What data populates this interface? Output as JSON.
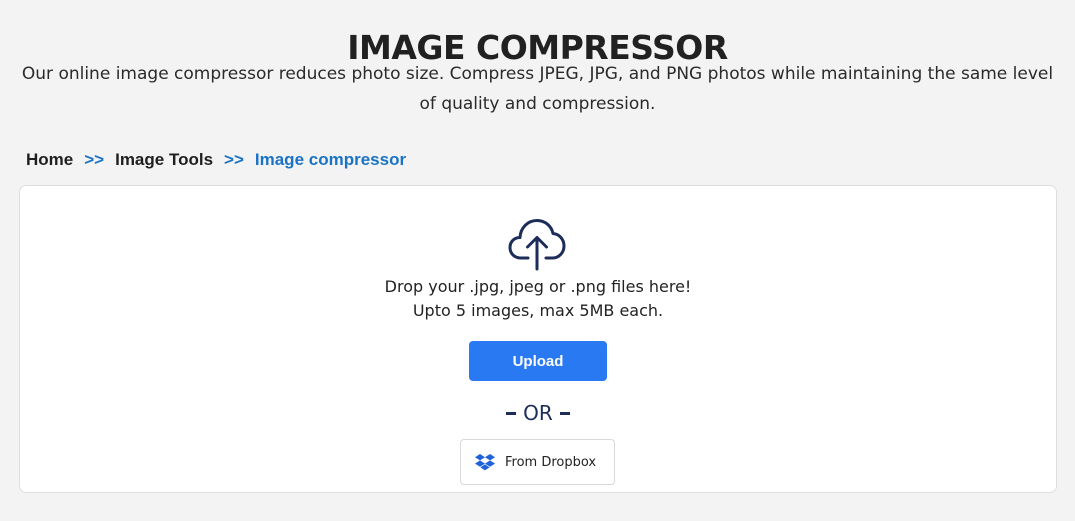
{
  "header": {
    "title": "IMAGE COMPRESSOR",
    "subtitle": "Our online image compressor reduces photo size. Compress JPEG, JPG, and PNG photos while maintaining the same level of quality and compression."
  },
  "breadcrumb": {
    "items": [
      "Home",
      "Image Tools",
      "Image compressor"
    ],
    "separator": ">>"
  },
  "uploader": {
    "icon": "cloud-upload-icon",
    "drop_text_line1": "Drop your .jpg, jpeg or .png files here!",
    "drop_text_line2": "Upto 5 images, max 5MB each.",
    "upload_label": "Upload",
    "or_label": "OR",
    "dropbox_label": "From Dropbox",
    "dropbox_icon": "dropbox-icon"
  },
  "colors": {
    "background": "#f3f3f3",
    "accent_blue": "#2979f2",
    "breadcrumb_blue": "#1a73c4",
    "navy": "#1c2d5a"
  }
}
